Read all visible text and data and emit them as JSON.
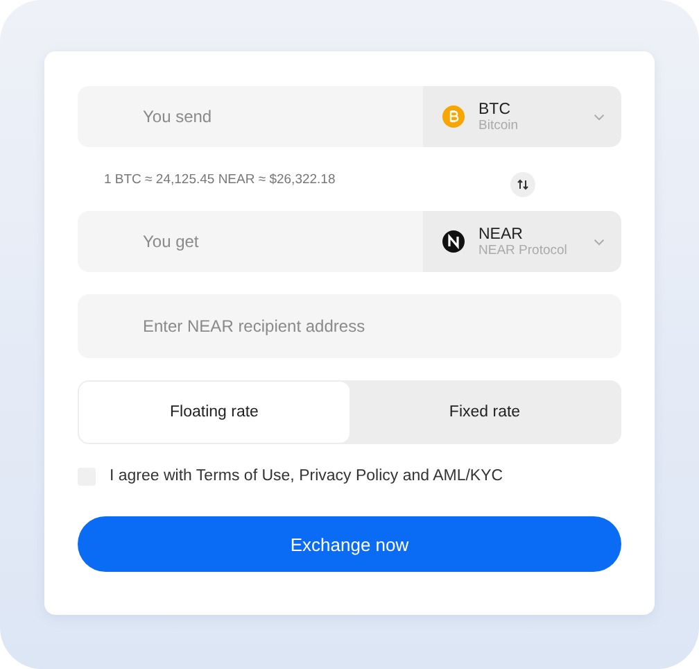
{
  "send": {
    "placeholder": "You send",
    "currency": {
      "code": "BTC",
      "name": "Bitcoin",
      "kind": "btc"
    }
  },
  "rate_info": "1 BTC ≈ 24,125.45 NEAR ≈ $26,322.18",
  "get": {
    "placeholder": "You get",
    "currency": {
      "code": "NEAR",
      "name": "NEAR Protocol",
      "kind": "near"
    }
  },
  "address": {
    "placeholder": "Enter NEAR recipient address"
  },
  "rate_tabs": [
    {
      "label": "Floating rate",
      "selected": true
    },
    {
      "label": "Fixed rate",
      "selected": false
    }
  ],
  "agreement": {
    "label": "I agree with Terms of Use, Privacy Policy and AML/KYC",
    "checked": false
  },
  "submit": "Exchange now"
}
